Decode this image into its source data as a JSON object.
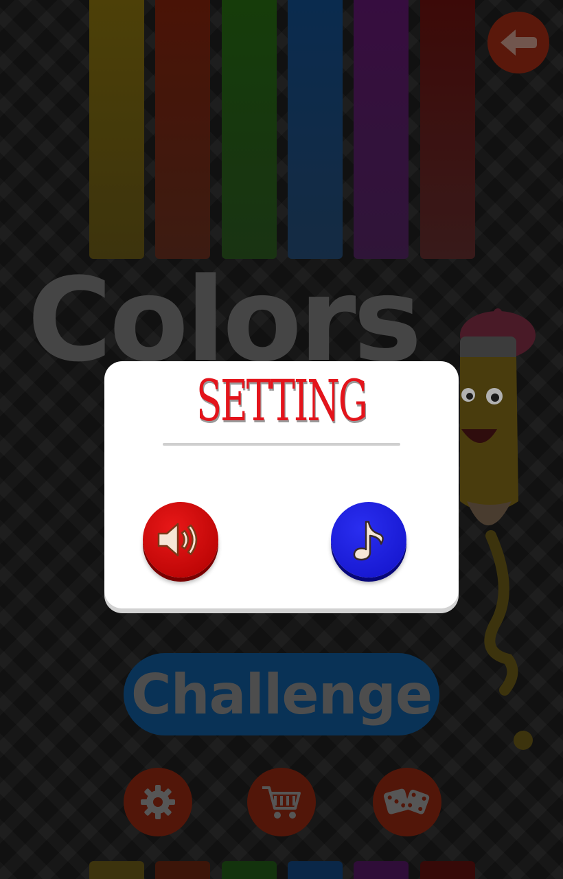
{
  "background": {
    "title": "Colors",
    "bar_colors": [
      "#5e4f0a",
      "#5a1808",
      "#1b4a0d",
      "#0d3560",
      "#43114d",
      "#4a0c0a"
    ],
    "bottom_bar_colors": [
      "#5e4f0a",
      "#5a1808",
      "#1b4a0d",
      "#0d3560",
      "#43114d",
      "#4a0c0a"
    ]
  },
  "header": {
    "back_icon": "back-arrow-icon"
  },
  "menu": {
    "challenge_label": "Challenge",
    "buttons": [
      {
        "icon": "gear-icon"
      },
      {
        "icon": "cart-icon"
      },
      {
        "icon": "dice-icon"
      }
    ]
  },
  "settings_dialog": {
    "title": "SETTING",
    "title_color": "#e3141b",
    "sound_toggle": {
      "icon": "speaker-icon",
      "color": "#d40f0f",
      "state": "on"
    },
    "music_toggle": {
      "icon": "music-note-icon",
      "color": "#1e22e0",
      "state": "on"
    }
  }
}
